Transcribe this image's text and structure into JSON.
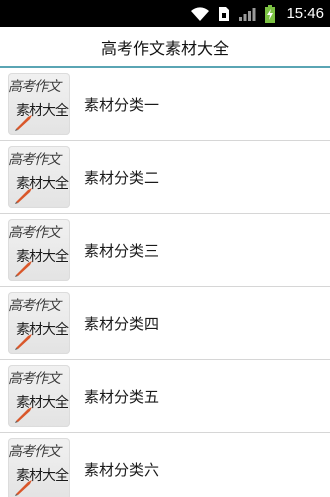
{
  "status_bar": {
    "time": "15:46",
    "icons": [
      "wifi-icon",
      "sim-icon",
      "signal-icon",
      "battery-charging-icon"
    ]
  },
  "app": {
    "title": "高考作文素材大全"
  },
  "thumbnail": {
    "line1": "高考作文",
    "line2": "素材大全"
  },
  "list": {
    "items": [
      {
        "label": "素材分类一"
      },
      {
        "label": "素材分类二"
      },
      {
        "label": "素材分类三"
      },
      {
        "label": "素材分类四"
      },
      {
        "label": "素材分类五"
      },
      {
        "label": "素材分类六"
      }
    ]
  },
  "colors": {
    "status_bar_bg": "#000000",
    "title_divider": "#5aa5b4",
    "row_divider": "#d6d6d6",
    "text": "#1a1a1a"
  }
}
